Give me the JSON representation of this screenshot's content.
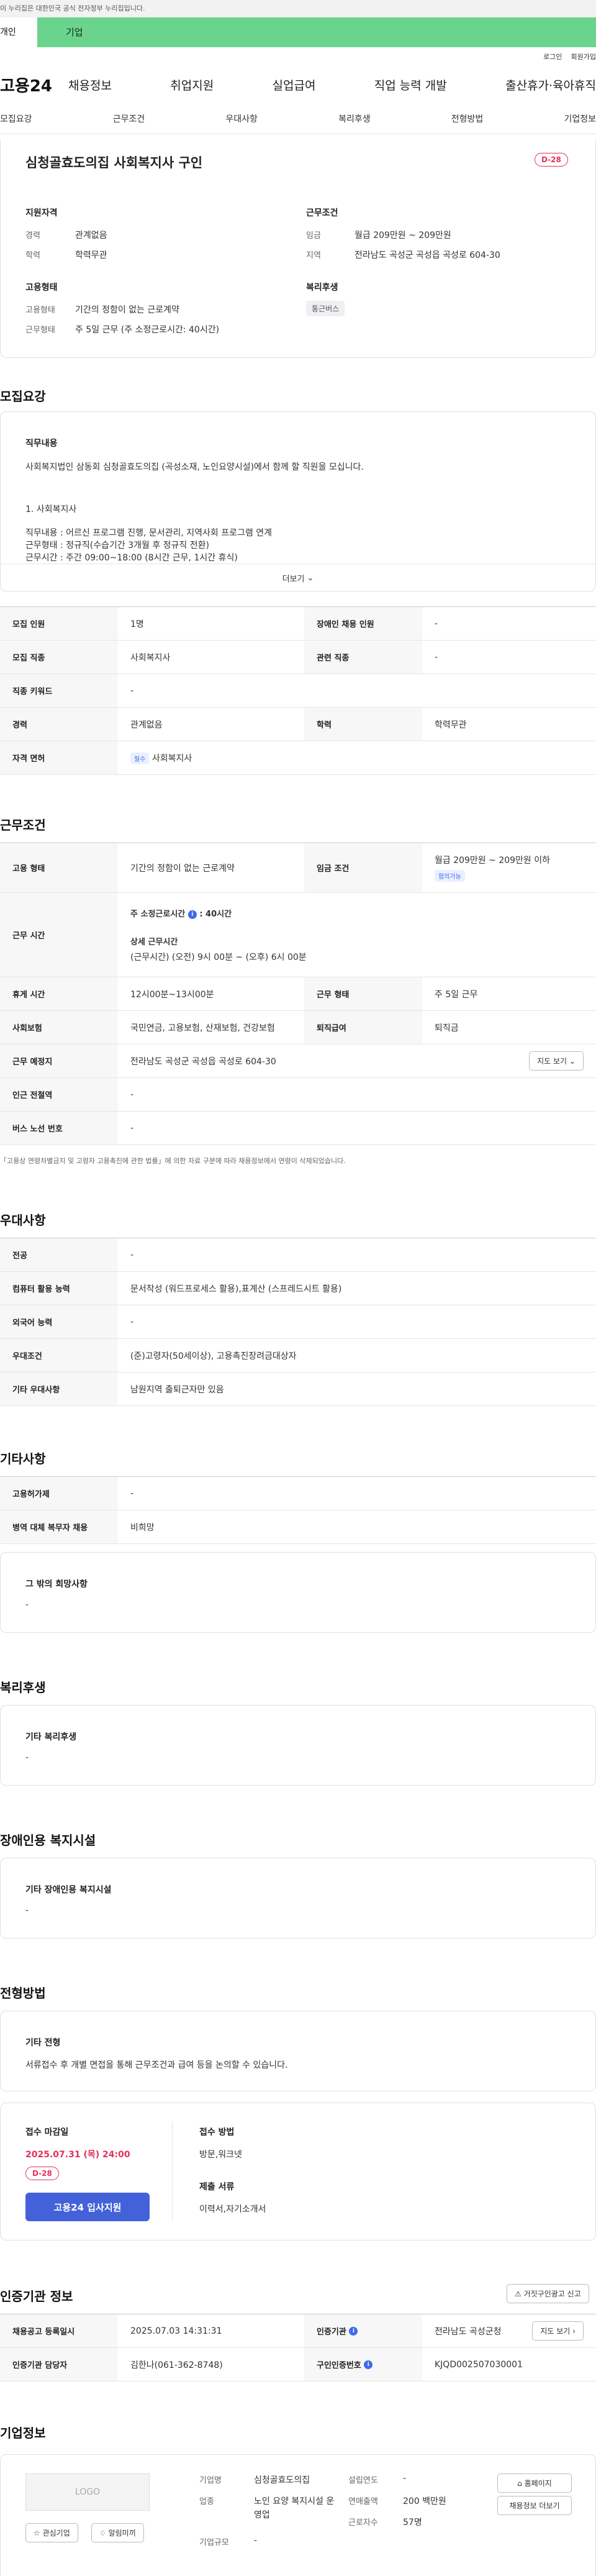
{
  "gov_notice": "이 누리집은 대한민국 공식 전자정부 누리집입니다.",
  "tabs": {
    "individual": "개인",
    "corporate": "기업"
  },
  "util": {
    "login": "로그인",
    "signup": "회원가입"
  },
  "logo": "고용24",
  "gnb": [
    "채용정보",
    "취업지원",
    "실업급여",
    "직업 능력 개발",
    "출산휴가·육아휴직"
  ],
  "subtabs": [
    "모집요강",
    "근무조건",
    "우대사항",
    "복리후생",
    "전형방법",
    "기업정보"
  ],
  "summary": {
    "title": "심청골효도의집 사회복지사 구인",
    "dday": "D-28",
    "qual_heading": "지원자격",
    "career_k": "경력",
    "career_v": "관계없음",
    "edu_k": "학력",
    "edu_v": "학력무관",
    "cond_heading": "근무조건",
    "wage_k": "임금",
    "wage_v": "월급 209만원 ~ 209만원",
    "area_k": "지역",
    "area_v": "전라남도 곡성군 곡성읍 곡성로 604-30",
    "emp_heading": "고용형태",
    "emptype_k": "고용형태",
    "emptype_v": "기간의 정함이 없는 근로계약",
    "worktype_k": "근무형태",
    "worktype_v": "주 5일 근무 (주 소정근로시간: 40시간)",
    "welfare_heading": "복리후생",
    "welfare_chip": "통근버스"
  },
  "recruit": {
    "heading": "모집요강",
    "duty_label": "직무내용",
    "duty_line": "사회복지법인 삼동회 심청골효도의집 (곡성소재, 노인요양시설)에서 함께 할 직원을 모십니다.",
    "item1": "1. 사회복지사",
    "duty_detail": "직무내용 : 어르신 프로그램 진행, 문서관리, 지역사회 프로그램 연계",
    "emp_detail": "근무형태 : 정규직(수습기간 3개월 후 정규직 전환)",
    "hours_detail": "근무시간 :  주간 09:00~18:00 (8시간 근무, 1시간 휴식)",
    "more": "더보기",
    "rows": [
      {
        "k1": "모집 인원",
        "v1": "1명",
        "k2": "장애인 채용 인원",
        "v2": "-"
      },
      {
        "k1": "모집 직종",
        "v1": "사회복지사",
        "k2": "관련 직종",
        "v2": "-"
      },
      {
        "k1": "직종 키워드",
        "v1": "-"
      },
      {
        "k1": "경력",
        "v1": "관계없음",
        "k2": "학력",
        "v2": "학력무관"
      },
      {
        "k1": "자격 면허",
        "badge": "필수",
        "v1": "사회복지사"
      }
    ]
  },
  "work": {
    "heading": "근무조건",
    "emp_k": "고용 형태",
    "emp_v": "기간의 정함이 없는 근로계약",
    "wage_k": "임금 조건",
    "wage_v": "월급 209만원 ~ 209만원 이하",
    "wage_tag": "협의가능",
    "time_k": "근무 시간",
    "time_weekly": "주 소정근로시간",
    "time_weekly_v": ": 40시간",
    "time_detail_label": "상세 근무시간",
    "time_detail": "(근무시간) (오전) 9시 00분 ~ (오후) 6시 00분",
    "break_k": "휴게 시간",
    "break_v": "12시00분~13시00분",
    "form_k": "근무 형태",
    "form_v": "주 5일 근무",
    "ins_k": "사회보험",
    "ins_v": "국민연금, 고용보험, 산재보험, 건강보험",
    "sev_k": "퇴직급여",
    "sev_v": "퇴직금",
    "place_k": "근무 예정지",
    "place_v": "전라남도 곡성군 곡성읍 곡성로 604-30",
    "map_btn": "지도 보기",
    "sub_k": "인근 전철역",
    "sub_v": "-",
    "bus_k": "버스 노선 번호",
    "bus_v": "-",
    "note": "「고용상 연령차별금지 및 고령자 고용촉진에 관한 법률」에 의한 자료 구분에 따라 채용정보에서 연령이 삭제되었습니다."
  },
  "pref": {
    "heading": "우대사항",
    "rows": [
      {
        "k": "전공",
        "v": "-"
      },
      {
        "k": "컴퓨터 활용 능력",
        "v": "문서작성 (워드프로세스 활용),표계산 (스프레드시트 활용)"
      },
      {
        "k": "외국어 능력",
        "v": "-"
      },
      {
        "k": "우대조건",
        "v": "(준)고령자(50세이상), 고용촉진장려금대상자"
      },
      {
        "k": "기타 우대사항",
        "v": "남원지역 출퇴근자만 있음"
      }
    ]
  },
  "etc": {
    "heading": "기타사항",
    "rows": [
      {
        "k": "고용허가제",
        "v": "-"
      },
      {
        "k": "병역 대체 복무자 채용",
        "v": "비희망"
      }
    ],
    "hope_label": "그 밖의 희망사항",
    "hope_v": "-"
  },
  "welfare": {
    "heading": "복리후생",
    "label": "기타 복리후생",
    "v": "-"
  },
  "disabled": {
    "heading": "장애인용 복지시설",
    "label": "기타 장애인용 복지시설",
    "v": "-"
  },
  "selection": {
    "heading": "전형방법",
    "label": "기타 전형",
    "v": "서류접수 후 개별 면접을 통해 근무조건과 급여 등을 논의할 수 있습니다.",
    "deadline_label": "접수 마감일",
    "deadline": "2025.07.31 (목) 24:00",
    "dday": "D-28",
    "apply_btn": "고용24 입사지원",
    "method_label": "접수 방법",
    "method_v": "방문,워크넷",
    "docs_label": "제출 서류",
    "docs_v": "이력서,자기소개서"
  },
  "cert": {
    "heading": "인증기관 정보",
    "report_btn": "거짓구인광고 신고",
    "reg_k": "채용공고 등록일시",
    "reg_v": "2025.07.03 14:31:31",
    "org_k": "인증기관",
    "org_v": "전라남도 곡성군청",
    "org_btn": "지도 보기",
    "mgr_k": "인증기관 담당자",
    "mgr_v": "김한나(061-362-8748)",
    "no_k": "구인인증번호",
    "no_v": "KJQD002507030001"
  },
  "company": {
    "heading": "기업정보",
    "logo": "LOGO",
    "fav_btn": "관심기업",
    "follow_btn": "알림미끼",
    "name_k": "기업명",
    "name_v": "심청골효도의집",
    "ind_k": "업종",
    "ind_v": "노인 요양 복지시설 운영업",
    "size_k": "기업규모",
    "size_v": "-",
    "est_k": "설립연도",
    "est_v": "-",
    "sales_k": "연매출액",
    "sales_v": "200 백만원",
    "emp_k": "근로자수",
    "emp_v": "57명",
    "home_btn": "홈페이지",
    "jobs_btn": "채용정보 더보기"
  }
}
